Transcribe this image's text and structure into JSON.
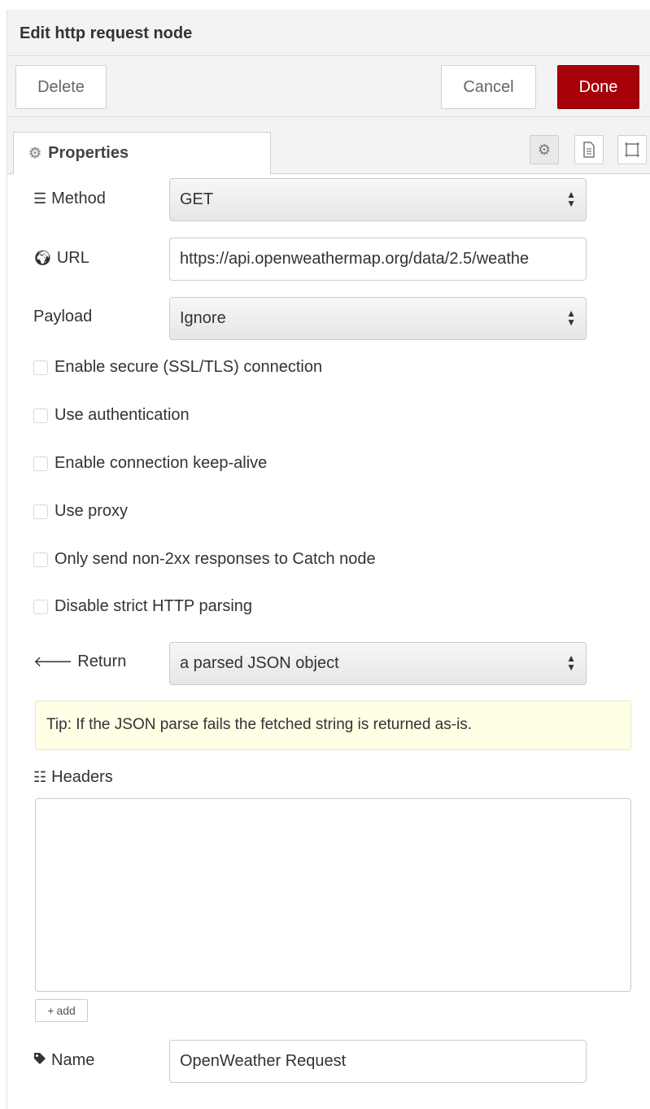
{
  "header": {
    "title": "Edit http request node"
  },
  "toolbar": {
    "delete_label": "Delete",
    "cancel_label": "Cancel",
    "done_label": "Done"
  },
  "tabs": {
    "properties_label": "Properties"
  },
  "form": {
    "method": {
      "label": "Method",
      "value": "GET"
    },
    "url": {
      "label": "URL",
      "value": "https://api.openweathermap.org/data/2.5/weathe"
    },
    "payload": {
      "label": "Payload",
      "value": "Ignore"
    },
    "checkboxes": [
      {
        "label": "Enable secure (SSL/TLS) connection",
        "checked": false
      },
      {
        "label": "Use authentication",
        "checked": false
      },
      {
        "label": "Enable connection keep-alive",
        "checked": false
      },
      {
        "label": "Use proxy",
        "checked": false
      },
      {
        "label": "Only send non-2xx responses to Catch node",
        "checked": false
      },
      {
        "label": "Disable strict HTTP parsing",
        "checked": false
      }
    ],
    "return": {
      "label": "Return",
      "value": "a parsed JSON object"
    },
    "tip": "Tip: If the JSON parse fails the fetched string is returned as-is.",
    "headers": {
      "label": "Headers",
      "add_label": "add"
    },
    "name": {
      "label": "Name",
      "value": "OpenWeather Request"
    }
  },
  "colors": {
    "done_button": "#a60009",
    "tip_background": "#ffffe6",
    "header_background": "#f3f3f3"
  }
}
